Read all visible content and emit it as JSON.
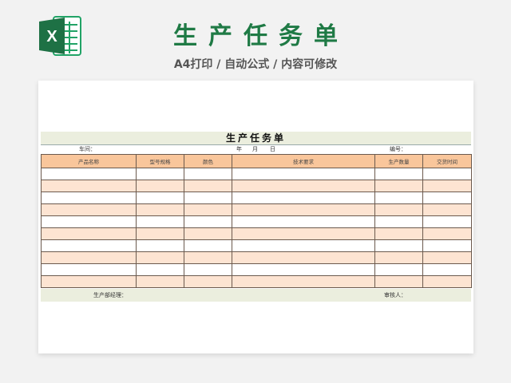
{
  "header": {
    "title": "生产任务单",
    "subtitle": "A4打印 / 自动公式 / 内容可修改",
    "logo_letter": "X"
  },
  "document": {
    "title": "生产任务单",
    "workshop_label": "车间：",
    "date_year": "年",
    "date_month": "月",
    "date_day": "日",
    "number_label": "编号：",
    "columns": [
      "产品名称",
      "型号规格",
      "颜色",
      "技术要求",
      "生产数量",
      "交货时间"
    ],
    "row_count": 10,
    "manager_label": "生产部经理：",
    "reviewer_label": "审核人："
  },
  "colors": {
    "brand_green": "#1f7a45",
    "header_fill": "#f9c69b",
    "band_fill": "#fde4d2",
    "title_band": "#ebeede"
  }
}
